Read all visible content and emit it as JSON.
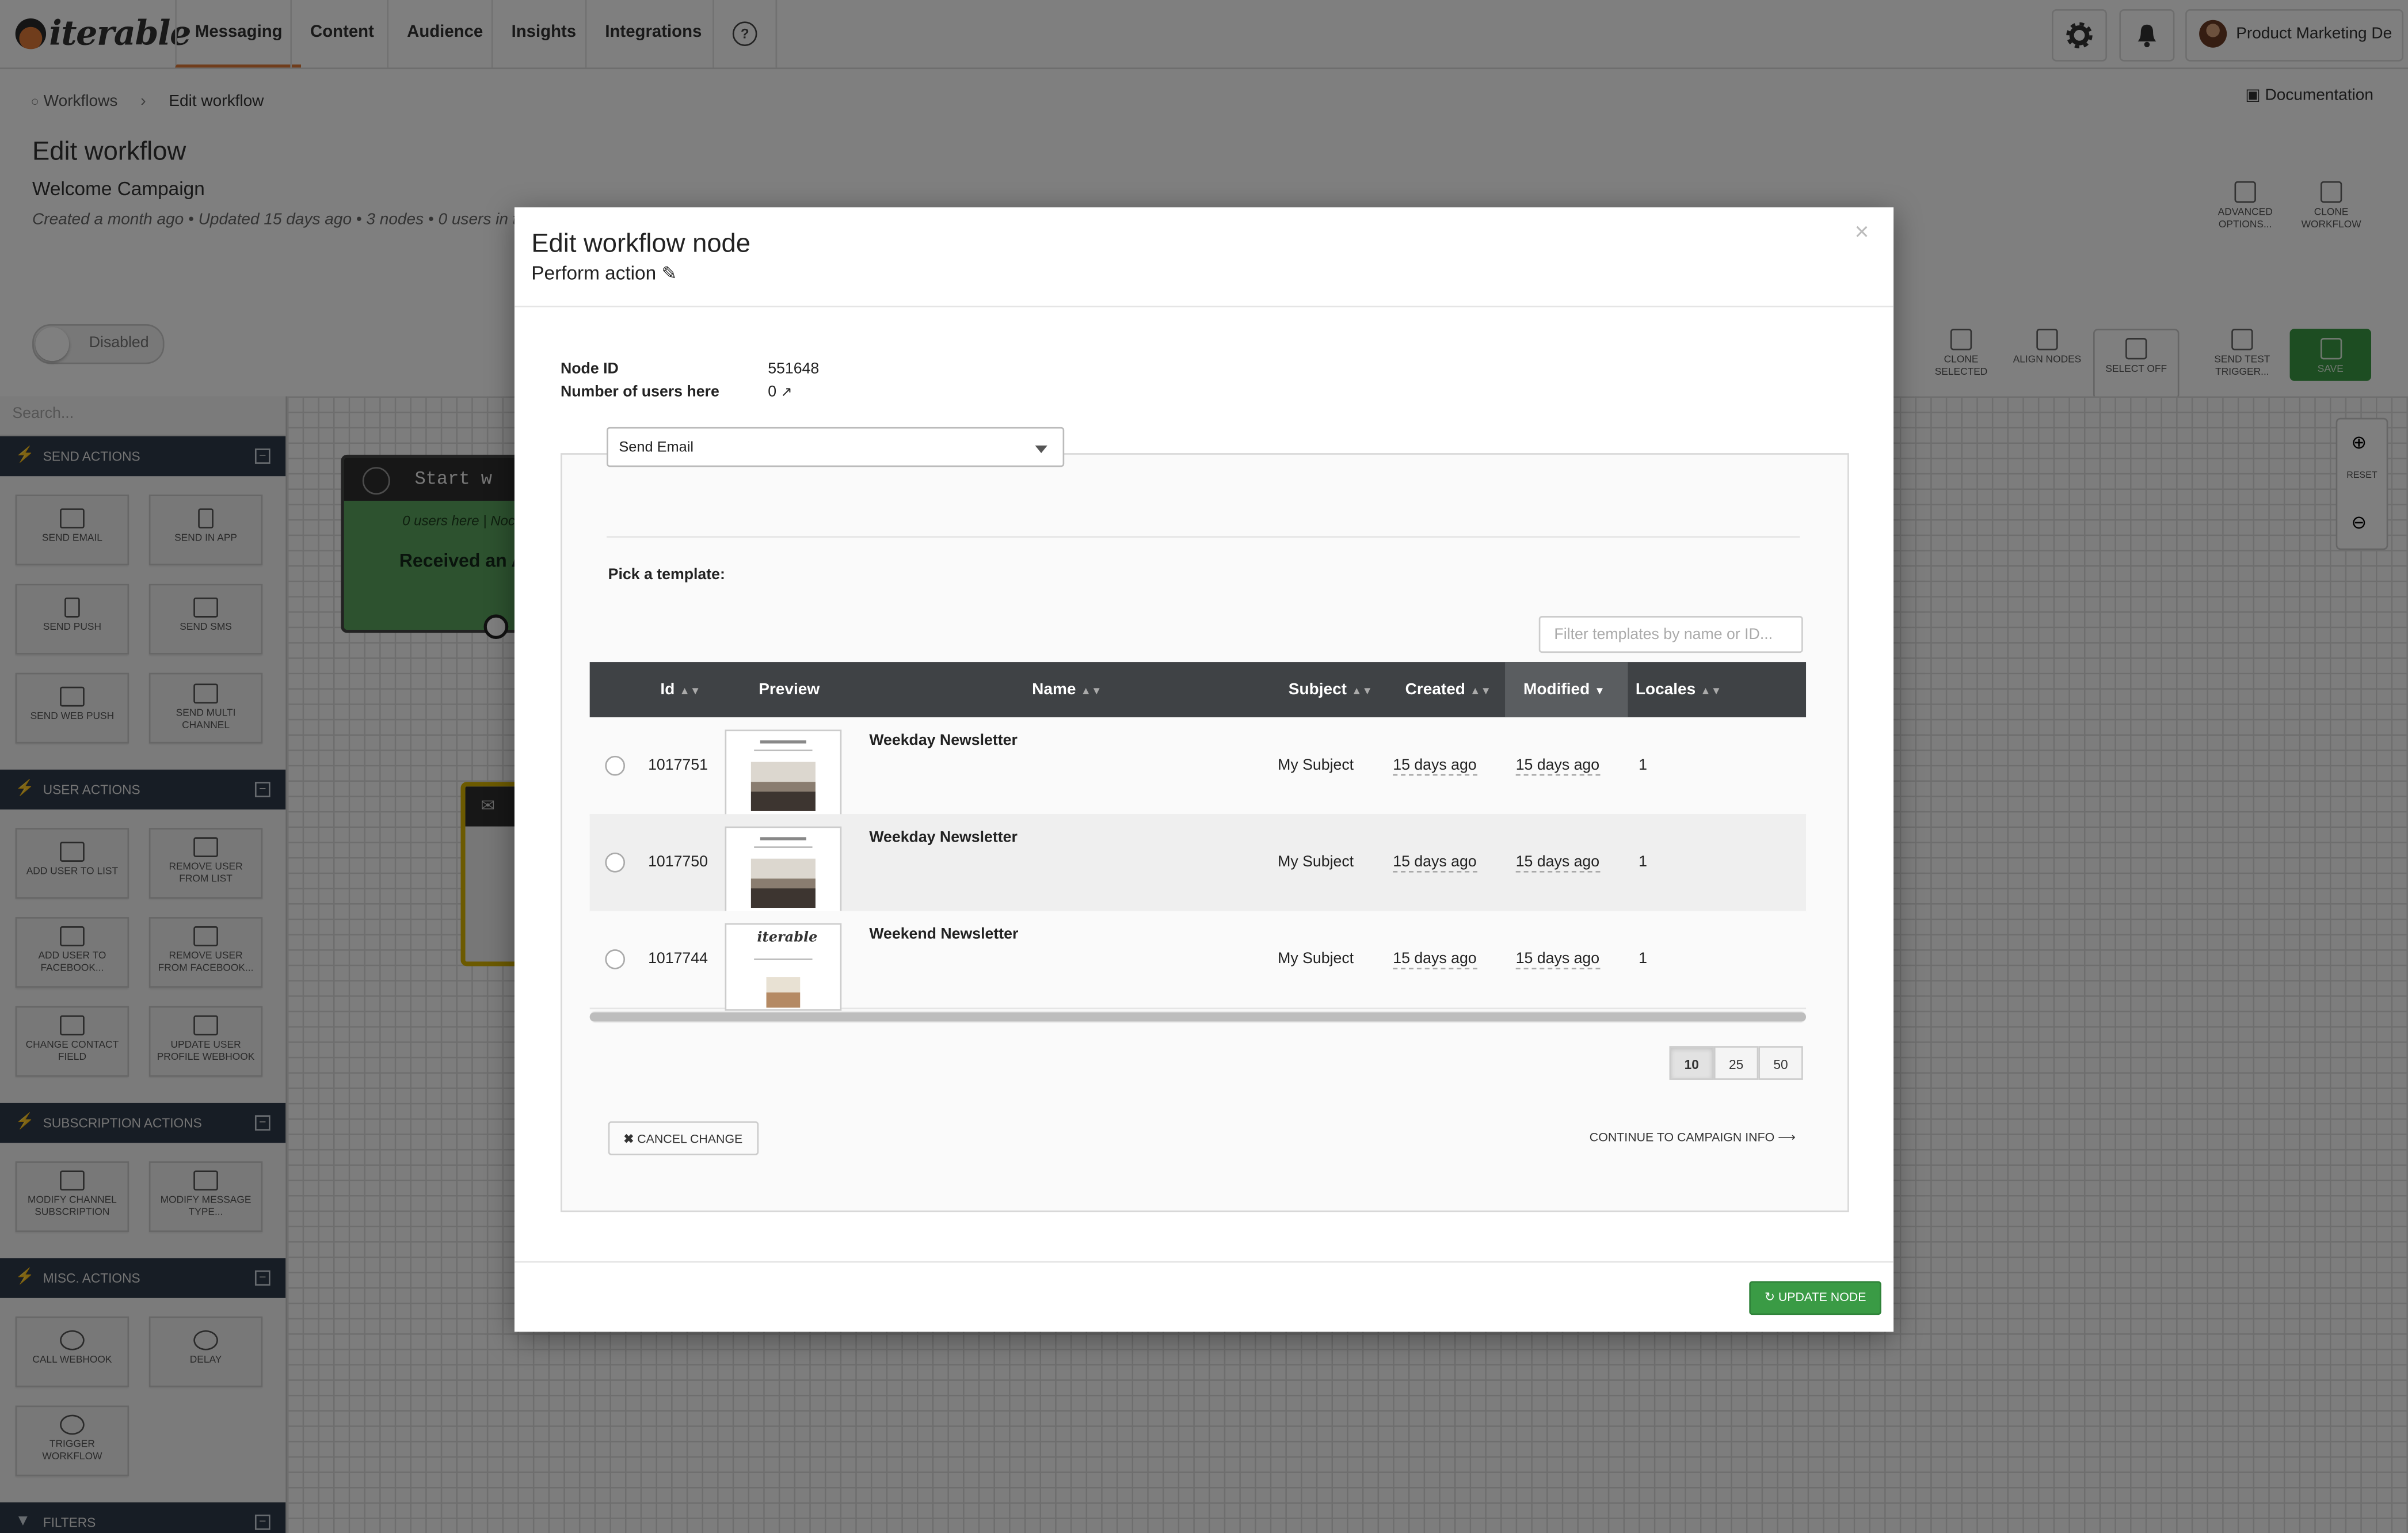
{
  "brand": {
    "logo_text": "iterable"
  },
  "nav": {
    "items": [
      "Messaging",
      "Content",
      "Audience",
      "Insights",
      "Integrations"
    ],
    "user_name": "Product Marketing De",
    "icons": {
      "help": "question-circle-icon",
      "settings": "gear-icon",
      "notifications": "bell-icon"
    }
  },
  "breadcrumb": {
    "parent": "Workflows",
    "current": "Edit workflow"
  },
  "documentation_label": "Documentation",
  "page": {
    "title": "Edit workflow",
    "workflow_name": "Welcome Campaign",
    "meta": "Created a month ago • Updated 15 days ago • 3 nodes • 0 users in t"
  },
  "toggle": {
    "label": "Disabled",
    "state": "off"
  },
  "toolbar": {
    "advanced": "ADVANCED OPTIONS...",
    "clone_workflow": "CLONE WORKFLOW",
    "clone_selected": "CLONE SELECTED",
    "align_nodes": "ALIGN NODES",
    "select_off": "SELECT OFF",
    "send_test": "SEND TEST TRIGGER...",
    "save": "SAVE"
  },
  "sidebar": {
    "search_placeholder": "Search...",
    "sections": [
      {
        "title": "SEND ACTIONS",
        "items": [
          "SEND EMAIL",
          "SEND IN APP",
          "SEND PUSH",
          "SEND SMS",
          "SEND WEB PUSH",
          "SEND MULTI CHANNEL"
        ]
      },
      {
        "title": "USER ACTIONS",
        "items": [
          "ADD USER TO LIST",
          "REMOVE USER FROM LIST",
          "ADD USER TO FACEBOOK...",
          "REMOVE USER FROM FACEBOOK...",
          "CHANGE CONTACT FIELD",
          "UPDATE USER PROFILE WEBHOOK"
        ]
      },
      {
        "title": "SUBSCRIPTION ACTIONS",
        "items": [
          "MODIFY CHANNEL SUBSCRIPTION",
          "MODIFY MESSAGE TYPE..."
        ]
      },
      {
        "title": "MISC. ACTIONS",
        "items": [
          "CALL WEBHOOK",
          "DELAY",
          "TRIGGER WORKFLOW"
        ]
      },
      {
        "title": "FILTERS",
        "items": []
      }
    ]
  },
  "canvas": {
    "start_node": {
      "title": "Start w",
      "users": "0 users here | Noc",
      "trigger": "Received an A"
    },
    "zoom": {
      "reset": "RESET"
    }
  },
  "modal": {
    "title": "Edit workflow node",
    "subtitle": "Perform action",
    "close": "×",
    "node_id_label": "Node ID",
    "node_id": "551648",
    "users_label": "Number of users here",
    "users_value": "0",
    "action_select": "Send Email",
    "pick_label": "Pick a template:",
    "filter_placeholder": "Filter templates by name or ID...",
    "columns": [
      "Id",
      "Preview",
      "Name",
      "Subject",
      "Created",
      "Modified",
      "Locales"
    ],
    "sorted_column": "Modified",
    "rows": [
      {
        "id": "1017751",
        "name": "Weekday Newsletter",
        "subject": "My Subject",
        "created": "15 days ago",
        "modified": "15 days ago",
        "locales": "1"
      },
      {
        "id": "1017750",
        "name": "Weekday Newsletter",
        "subject": "My Subject",
        "created": "15 days ago",
        "modified": "15 days ago",
        "locales": "1"
      },
      {
        "id": "1017744",
        "name": "Weekend Newsletter",
        "subject": "My Subject",
        "created": "15 days ago",
        "modified": "15 days ago",
        "locales": "1"
      }
    ],
    "page_sizes": [
      "10",
      "25",
      "50"
    ],
    "page_size_selected": "10",
    "cancel": "CANCEL CHANGE",
    "continue": "CONTINUE TO CAMPAIGN INFO",
    "update": "UPDATE NODE"
  },
  "colors": {
    "accent": "#e07b39",
    "success": "#3a9b45",
    "sidebar_section": "#2f3a4a",
    "table_header": "#3f4245"
  }
}
